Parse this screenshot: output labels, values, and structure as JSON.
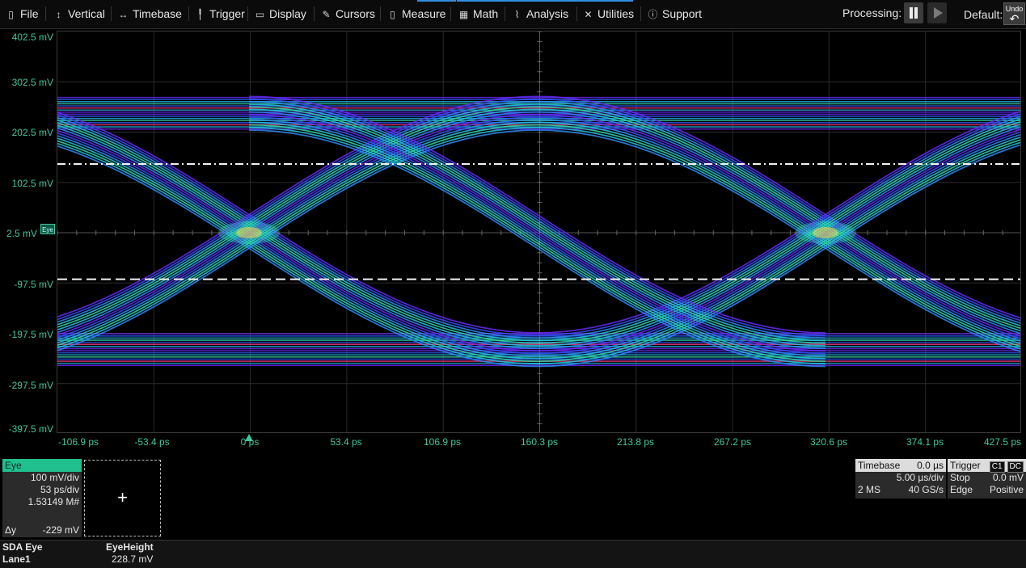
{
  "menu": [
    {
      "label": "File",
      "icon": "file-icon"
    },
    {
      "label": "Vertical",
      "icon": "vertical-arrows-icon"
    },
    {
      "label": "Timebase",
      "icon": "horizontal-arrows-icon"
    },
    {
      "label": "Trigger",
      "icon": "trigger-icon"
    },
    {
      "label": "Display",
      "icon": "display-icon"
    },
    {
      "label": "Cursors",
      "icon": "cursor-icon"
    },
    {
      "label": "Measure",
      "icon": "measure-icon"
    },
    {
      "label": "Math",
      "icon": "calculator-icon"
    },
    {
      "label": "Analysis",
      "icon": "chart-line-icon"
    },
    {
      "label": "Utilities",
      "icon": "tools-icon"
    },
    {
      "label": "Support",
      "icon": "info-icon"
    }
  ],
  "processing_label": "Processing:",
  "default_label": "Default:",
  "undo_label": "Undo",
  "plot": {
    "y_ticks": [
      "402.5 mV",
      "302.5 mV",
      "202.5 mV",
      "102.5 mV",
      "2.5 mV",
      "-97.5 mV",
      "-197.5 mV",
      "-297.5 mV",
      "-397.5 mV"
    ],
    "x_ticks": [
      "-106.9 ps",
      "-53.4 ps",
      "0 ps",
      "53.4 ps",
      "106.9 ps",
      "160.3 ps",
      "213.8 ps",
      "267.2 ps",
      "320.6 ps",
      "374.1 ps",
      "427.5 ps"
    ],
    "channel_marker": "Eye",
    "upper_level_mv": 139,
    "lower_level_mv": -90,
    "accent_color": "#3ec6a0"
  },
  "eye_panel": {
    "title": "Eye",
    "vdiv": "100 mV/div",
    "tdiv": "53 ps/div",
    "count": "1.53149 M#",
    "dy_label": "Δy",
    "dy_value": "-229 mV"
  },
  "add_symbol": "+",
  "timebase_panel": {
    "title": "Timebase",
    "offset": "0.0 µs",
    "tdiv": "5.00 µs/div",
    "samples": "2 MS",
    "rate": "40 GS/s"
  },
  "trigger_panel": {
    "title": "Trigger",
    "ch": "C1",
    "coupling": "DC",
    "mode": "Stop",
    "level": "0.0 mV",
    "type": "Edge",
    "slope": "Positive"
  },
  "measurement": {
    "source_line1": "SDA Eye",
    "source_line2": "Lane1",
    "param": "EyeHeight",
    "value": "228.7 mV"
  }
}
